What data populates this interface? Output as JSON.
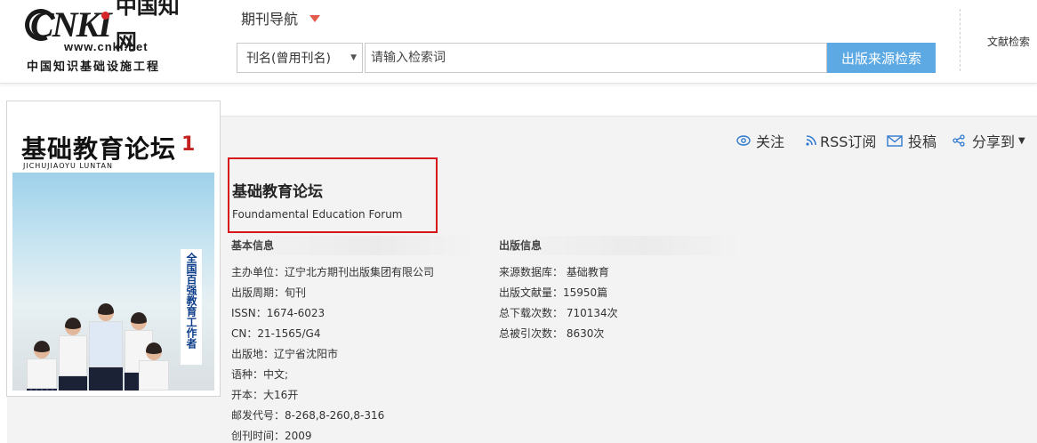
{
  "logo": {
    "brand": "CNKI",
    "cn": "中国知网",
    "url": "www.cnki.net",
    "subtitle": "中国知识基础设施工程"
  },
  "nav": {
    "title": "期刊导航"
  },
  "search": {
    "field_select": "刊名(曾用刊名)",
    "placeholder": "请输入检索词",
    "button": "出版来源检索"
  },
  "header_right": {
    "link": "文献检索"
  },
  "actions": {
    "follow": "关注",
    "rss": "RSS订阅",
    "submit": "投稿",
    "share": "分享到"
  },
  "journal": {
    "title_cn": "基础教育论坛",
    "title_en": "Foundamental Education Forum",
    "cover": {
      "title": "基础教育论坛",
      "issue": "1",
      "pinyin": "JICHUJIAOYU  LUNTAN",
      "tag": "全国百强教育工作者"
    }
  },
  "basic_info": {
    "heading": "基本信息",
    "fields": [
      "主办单位：辽宁北方期刊出版集团有限公司",
      "出版周期：旬刊",
      "ISSN：1674-6023",
      "CN：21-1565/G4",
      "出版地：辽宁省沈阳市",
      "语种：中文;",
      "开本：大16开",
      "邮发代号：8-268,8-260,8-316",
      "创刊时间：2009"
    ]
  },
  "pub_info": {
    "heading": "出版信息",
    "fields": [
      "来源数据库： 基础教育",
      "出版文献量：15950篇",
      "总下载次数： 710134次",
      "总被引次数： 8630次"
    ]
  },
  "colors": {
    "accent_blue": "#5da9e4",
    "highlight_red": "#d8151b",
    "caret_red": "#e25c4e"
  }
}
